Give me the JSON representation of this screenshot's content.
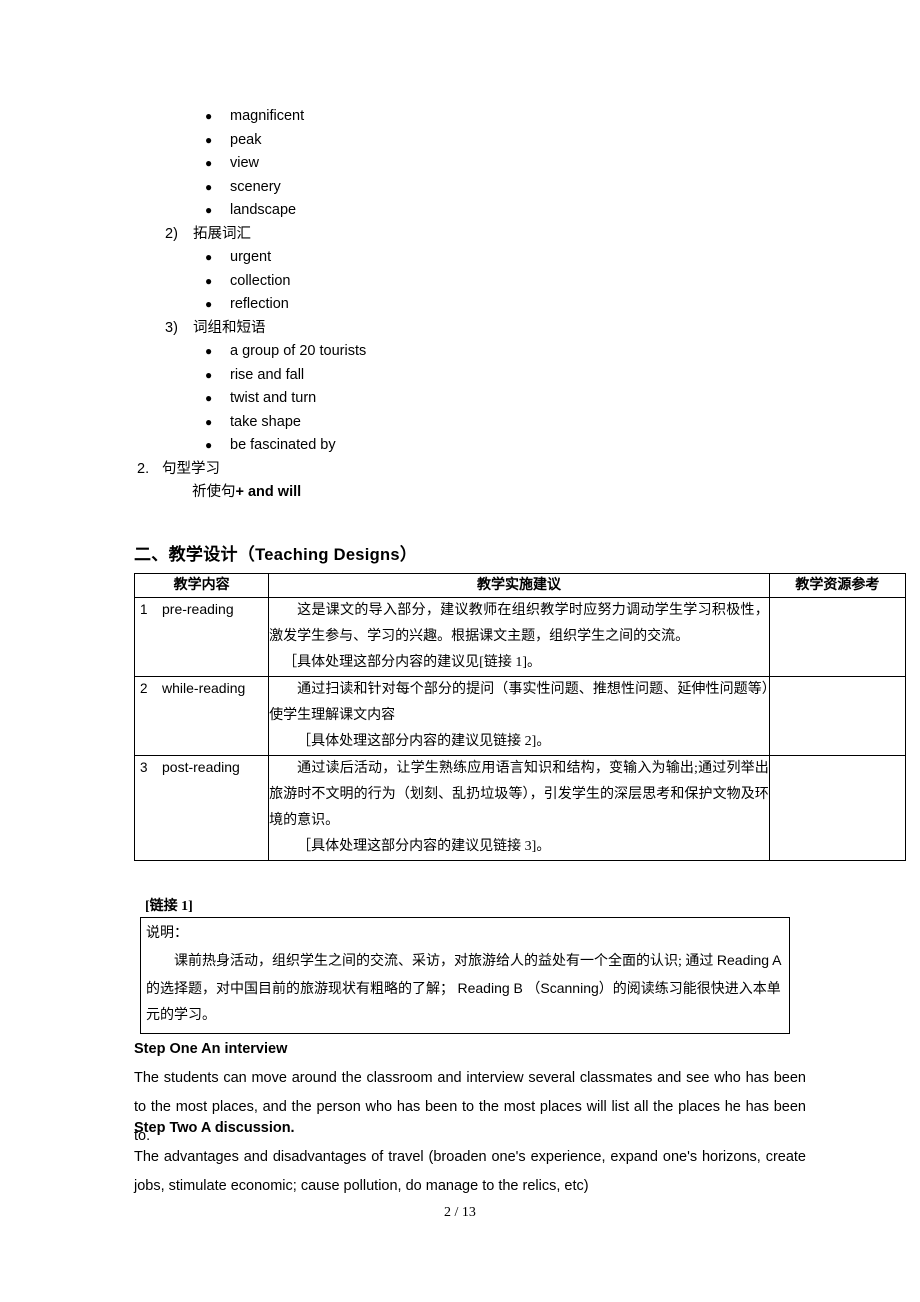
{
  "outline": {
    "groups": [
      {
        "type": "bullets",
        "items": [
          "magnificent",
          "peak",
          "view",
          "scenery",
          "landscape"
        ]
      },
      {
        "type": "numbered",
        "marker": "2)",
        "label": "拓展词汇",
        "items": [
          "urgent",
          "collection",
          "reflection"
        ]
      },
      {
        "type": "numbered",
        "marker": "3)",
        "label": "词组和短语",
        "items": [
          "a group of 20 tourists",
          "rise and fall",
          "twist and turn",
          "take shape",
          "be fascinated by"
        ]
      }
    ],
    "section2": {
      "marker": "2.",
      "label": "句型学习",
      "content_cn": "祈使句",
      "content_en": "+ and will"
    }
  },
  "heading": {
    "prefix": "二、教学设计（",
    "english": "Teaching Designs",
    "suffix": "）"
  },
  "table": {
    "headers": [
      "教学内容",
      "教学实施建议",
      "教学资源参考"
    ],
    "rows": [
      {
        "index": "1",
        "topic": "pre-reading",
        "body": [
          "这是课文的导入部分，建议教师在组织教学时应努力调动学生学习积极性，激发学生参与、学习的兴趣。根据课文主题，组织学生之间的交流。",
          "［具体处理这部分内容的建议见[链接 1]。"
        ],
        "resource": ""
      },
      {
        "index": "2",
        "topic": "while-reading",
        "body": [
          "通过扫读和针对每个部分的提问（事实性问题、推想性问题、延伸性问题等）使学生理解课文内容",
          "［具体处理这部分内容的建议见链接 2]。"
        ],
        "resource": ""
      },
      {
        "index": "3",
        "topic": "post-reading",
        "body": [
          "通过读后活动，让学生熟练应用语言知识和结构，变输入为输出;通过列举出旅游时不文明的行为（划刻、乱扔垃圾等），引发学生的深层思考和保护文物及环境的意识。",
          "［具体处理这部分内容的建议见链接 3]。"
        ],
        "resource": ""
      }
    ]
  },
  "link_label": "[链接 1]",
  "note_box": {
    "title": "说明：",
    "line1_a": "课前热身活动，组织学生之间的交流、采访，对旅游给人的益处有一个全面的认识; 通过 ",
    "line1_en1": "Reading A",
    "line1_b": " 的选择题，对中国目前的旅游现状有粗略的了解； ",
    "line1_en2": "Reading B",
    "line1_c": " （",
    "line1_en3": "Scanning",
    "line1_d": "）的阅读练习能很快进入本单元的学习。"
  },
  "steps": [
    {
      "title": "Step One An interview",
      "paragraph": "The students can move around the classroom and interview several classmates and see who has been to the most places, and the person who has been to the most places will list all the places he has been to."
    },
    {
      "title": "Step Two A discussion.",
      "paragraph": "The advantages and disadvantages of travel (broaden one's experience, expand one's horizons, create jobs, stimulate economic; cause pollution, do manage to the relics, etc)"
    }
  ],
  "footer": {
    "page_number": "2  / 13"
  }
}
